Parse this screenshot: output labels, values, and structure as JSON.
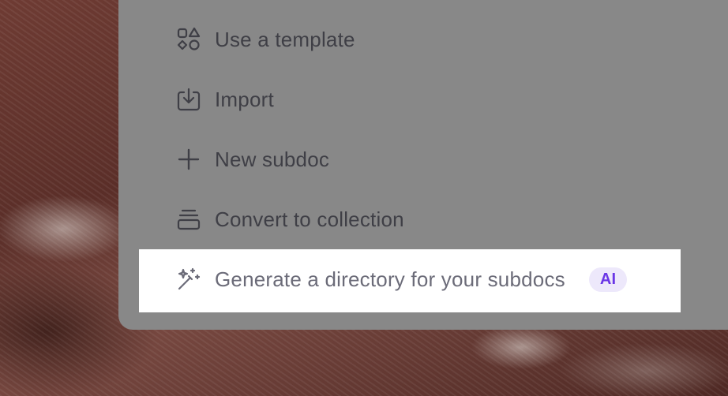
{
  "menu": {
    "items": [
      {
        "label": "Use a template",
        "icon": "template-icon"
      },
      {
        "label": "Import",
        "icon": "import-icon"
      },
      {
        "label": "New subdoc",
        "icon": "plus-icon"
      },
      {
        "label": "Convert to collection",
        "icon": "collection-icon"
      },
      {
        "label": "Generate a directory for your subdocs",
        "icon": "magic-wand-icon",
        "badge": "AI"
      }
    ]
  },
  "colors": {
    "panel_overlay": "#888888",
    "highlight_bg": "#ffffff",
    "badge_bg": "#ede8fb",
    "badge_text": "#6a36e6"
  }
}
